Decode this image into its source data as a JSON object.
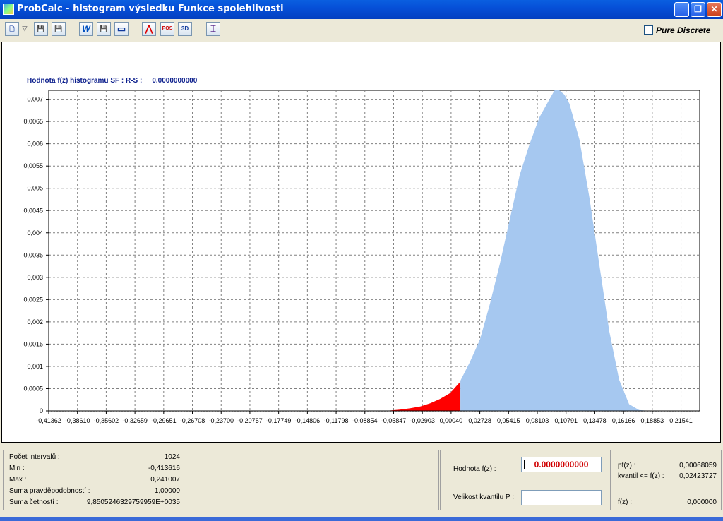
{
  "window": {
    "title": "ProbCalc - histogram  výsledku Funkce spolehlivosti",
    "minimize_glyph": "_",
    "maximize_glyph": "❐",
    "close_glyph": "✕"
  },
  "toolbar": {
    "buttons": [
      {
        "icon": "new-file-icon",
        "glyph": "🗋"
      },
      {
        "icon": "dropdown-arrow-icon",
        "glyph": "▽"
      },
      {
        "icon": "save-icon",
        "glyph": "💾"
      },
      {
        "icon": "save-as-icon",
        "glyph": "💾"
      },
      {
        "icon": "w-icon",
        "glyph": "W"
      },
      {
        "icon": "floppy-icon",
        "glyph": "💾"
      },
      {
        "icon": "rectangle-icon",
        "glyph": "▭"
      },
      {
        "icon": "line-chart-icon",
        "glyph": "⋀"
      },
      {
        "icon": "pos-icon",
        "glyph": "POS"
      },
      {
        "icon": "3d-icon",
        "glyph": "3D"
      },
      {
        "icon": "tool-icon",
        "glyph": "⌶"
      }
    ],
    "pure_discrete_label": "Pure Discrete",
    "pure_discrete_checked": false
  },
  "chart_header": {
    "label": "Hodnota f(z) histogramu SF : R-S :",
    "value": "0.0000000000"
  },
  "chart_data": {
    "type": "area",
    "title": "",
    "xlabel": "",
    "ylabel": "",
    "xlim": [
      -0.41362,
      0.241
    ],
    "ylim": [
      0,
      0.0072
    ],
    "x_tick_labels": [
      "-0,41362",
      "-0,38610",
      "-0,35602",
      "-0,32659",
      "-0,29651",
      "-0,26708",
      "-0,23700",
      "-0,20757",
      "-0,17749",
      "-0,14806",
      "-0,11798",
      "-0,08854",
      "-0,05847",
      "-0,02903",
      "0,00040",
      "0,02728",
      "0,05415",
      "0,08103",
      "0,10791",
      "0,13478",
      "0,16166",
      "0,18853",
      "0,21541"
    ],
    "y_tick_labels": [
      "0",
      "0,0005",
      "0,001",
      "0,0015",
      "0,002",
      "0,0025",
      "0,003",
      "0,0035",
      "0,004",
      "0,0045",
      "0,005",
      "0,0055",
      "0,006",
      "0,0065",
      "0,007"
    ],
    "y_ticks": [
      0,
      0.0005,
      0.001,
      0.0015,
      0.002,
      0.0025,
      0.003,
      0.0035,
      0.004,
      0.0045,
      0.005,
      0.0055,
      0.006,
      0.0065,
      0.007
    ],
    "grid": true,
    "series": [
      {
        "color": "#ff0000",
        "x": [
          -0.075,
          -0.06,
          -0.05,
          -0.04,
          -0.03,
          -0.02,
          -0.01,
          0.0,
          0.0004
        ],
        "y": [
          0.0,
          3e-05,
          6e-05,
          0.0001,
          0.00017,
          0.00027,
          0.0004,
          0.00065,
          0.00068
        ]
      },
      {
        "color": "#a6c8f0",
        "x": [
          0.0004,
          0.01,
          0.02,
          0.03,
          0.04,
          0.05,
          0.06,
          0.07,
          0.08,
          0.09,
          0.095,
          0.1,
          0.105,
          0.11,
          0.12,
          0.13,
          0.14,
          0.15,
          0.16,
          0.17,
          0.18,
          0.19
        ],
        "y": [
          0.00068,
          0.0011,
          0.0016,
          0.0024,
          0.0033,
          0.0043,
          0.0053,
          0.006,
          0.0066,
          0.007,
          0.0072,
          0.0072,
          0.0071,
          0.0069,
          0.0061,
          0.0048,
          0.0033,
          0.0018,
          0.0007,
          0.00015,
          2e-05,
          0.0
        ]
      }
    ]
  },
  "stats": {
    "items": [
      {
        "label": "Počet intervalů :",
        "value": "1024"
      },
      {
        "label": "Min :",
        "value": "-0,413616"
      },
      {
        "label": "Max :",
        "value": "0,241007"
      },
      {
        "label": "Suma pravděpodobností :",
        "value": "1,00000"
      },
      {
        "label": "Suma četností :",
        "value": "9,8505246329759959E+0035"
      }
    ]
  },
  "controls": {
    "fz_label": "Hodnota f(z) :",
    "fz_value": "0.0000000000",
    "quantile_label": "Velikost kvantilu P :",
    "quantile_value": ""
  },
  "results": {
    "items": [
      {
        "label": "pf(z) :",
        "value": "0,00068059"
      },
      {
        "label": "kvantil <= f(z) :",
        "value": "0,02423727"
      },
      {
        "label": "f(z) :",
        "value": "0,000000"
      }
    ]
  }
}
